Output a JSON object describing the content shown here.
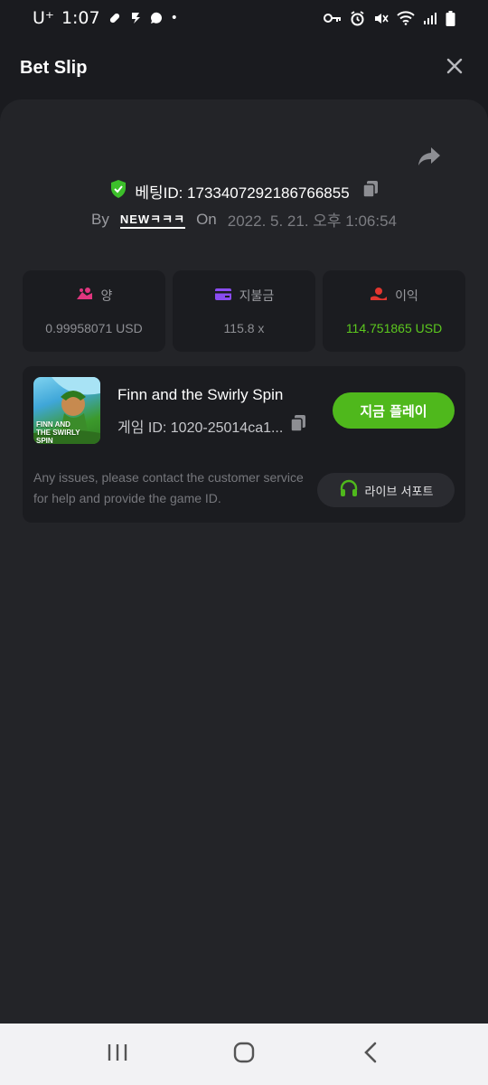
{
  "status_bar": {
    "carrier": "U⁺",
    "time": "1:07",
    "dot": "•"
  },
  "header": {
    "title": "Bet Slip",
    "close_icon": "close-icon"
  },
  "bet": {
    "id_text": "베팅ID: 1733407292186766855",
    "by_label": "By",
    "username": "NEWㅋㅋㅋ",
    "on_label": "On",
    "date": "2022. 5. 21. 오후 1:06:54"
  },
  "stats": [
    {
      "label": "양",
      "value": "0.99958071 USD",
      "icon": "coins-icon",
      "color": "#e0367f"
    },
    {
      "label": "지불금",
      "value": "115.8 x",
      "icon": "card-icon",
      "color": "#8a4cf0"
    },
    {
      "label": "이익",
      "value": "114.751865 USD",
      "icon": "profit-icon",
      "color": "#e2362f",
      "value_color": "#5cc81e"
    }
  ],
  "game": {
    "title": "Finn and the Swirly Spin",
    "id_text": "게임 ID: 1020-25014ca1...",
    "play_label": "지금 플레이",
    "thumb_text": "FINN AND THE SWIRLY SPIN",
    "support_text": "Any issues, please contact the customer service for help and provide the game ID.",
    "support_label": "라이브 서포트"
  },
  "colors": {
    "accent_green": "#4fb81c",
    "background": "#1a1b1f",
    "card": "#1b1c20"
  }
}
